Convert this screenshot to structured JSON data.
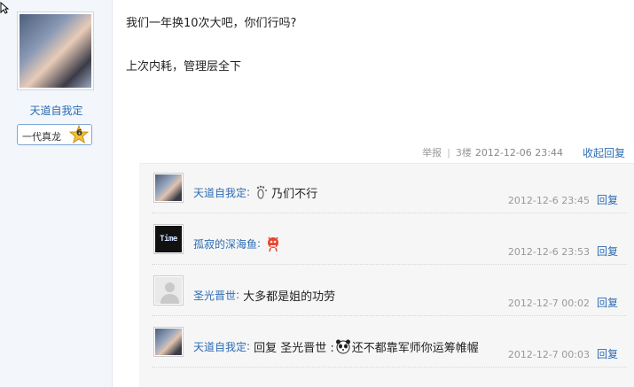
{
  "author": {
    "name": "天道自我定",
    "rank_label": "一代真龙",
    "rank_level": "6"
  },
  "post": {
    "line1": "我们一年换10次大吧，你们行吗?",
    "line2": "上次内耗，管理层全下"
  },
  "meta": {
    "report": "举报",
    "floor": "3楼",
    "datetime": "2012-12-06 23:44",
    "collapse": "收起回复"
  },
  "replies": [
    {
      "user": "天道自我定",
      "colon": ":",
      "content": "乃们不行",
      "time": "2012-12-6 23:45",
      "reply": "回复",
      "avatar": "girl-photo",
      "emoticon": "footprint-icon"
    },
    {
      "user": "孤寂的深海鱼",
      "colon": ":",
      "content": "",
      "time": "2012-12-6 23:53",
      "reply": "回复",
      "avatar": "time-logo",
      "avatar_text": "Time",
      "emoticon": "red-creature-icon"
    },
    {
      "user": "圣光晋世",
      "colon": ":",
      "content": "大多都是姐的功劳",
      "time": "2012-12-7 00:02",
      "reply": "回复",
      "avatar": "default-user"
    },
    {
      "user": "天道自我定",
      "colon": ":",
      "content_prefix": "回复 圣光晋世 :",
      "content": "还不都靠军师你运筹帷幄",
      "time": "2012-12-7 00:03",
      "reply": "回复",
      "avatar": "girl-photo",
      "emoticon": "panda-icon"
    }
  ],
  "colors": {
    "link": "#2c6cb5",
    "sidebar_bg": "#f3f6fb",
    "reply_bg": "#f6f6f6"
  }
}
